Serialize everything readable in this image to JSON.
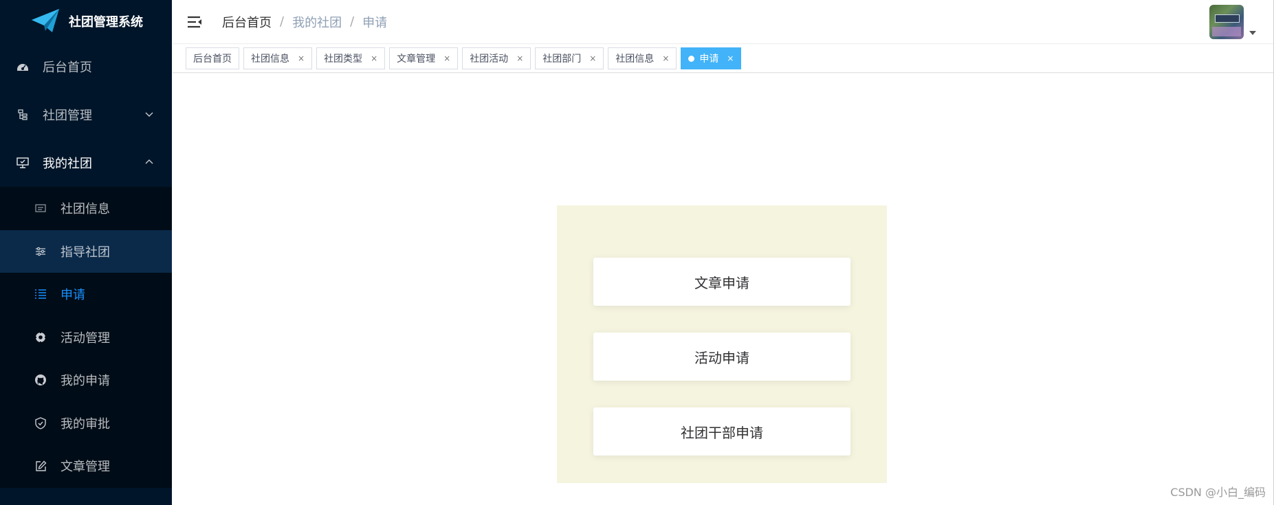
{
  "app": {
    "title": "社团管理系统"
  },
  "sidebar": {
    "items": [
      {
        "label": "后台首页",
        "icon": "dashboard-icon"
      },
      {
        "label": "社团管理",
        "icon": "tree-icon",
        "expanded": false
      },
      {
        "label": "我的社团",
        "icon": "monitor-icon",
        "expanded": true
      }
    ],
    "submenu": [
      {
        "label": "社团信息",
        "icon": "card-icon"
      },
      {
        "label": "指导社团",
        "icon": "sliders-icon"
      },
      {
        "label": "申请",
        "icon": "list-icon",
        "active": true
      },
      {
        "label": "活动管理",
        "icon": "gear-icon"
      },
      {
        "label": "我的申请",
        "icon": "github-icon"
      },
      {
        "label": "我的审批",
        "icon": "shield-check-icon"
      },
      {
        "label": "文章管理",
        "icon": "edit-icon"
      }
    ]
  },
  "header": {
    "breadcrumb": [
      "后台首页",
      "我的社团",
      "申请"
    ],
    "separator": "/"
  },
  "tags": [
    {
      "label": "后台首页",
      "closable": false
    },
    {
      "label": "社团信息",
      "closable": true
    },
    {
      "label": "社团类型",
      "closable": true
    },
    {
      "label": "文章管理",
      "closable": true
    },
    {
      "label": "社团活动",
      "closable": true
    },
    {
      "label": "社团部门",
      "closable": true
    },
    {
      "label": "社团信息",
      "closable": true
    },
    {
      "label": "申请",
      "closable": true,
      "active": true
    }
  ],
  "tag_close": "×",
  "main": {
    "buttons": [
      "文章申请",
      "活动申请",
      "社团干部申请"
    ]
  },
  "watermark": "CSDN @小白_编码",
  "colors": {
    "sidebar_bg": "#001529",
    "submenu_bg": "#000c17",
    "accent": "#1890ff",
    "active_tag": "#42b3f8",
    "panel_bg": "#f5f4df"
  }
}
